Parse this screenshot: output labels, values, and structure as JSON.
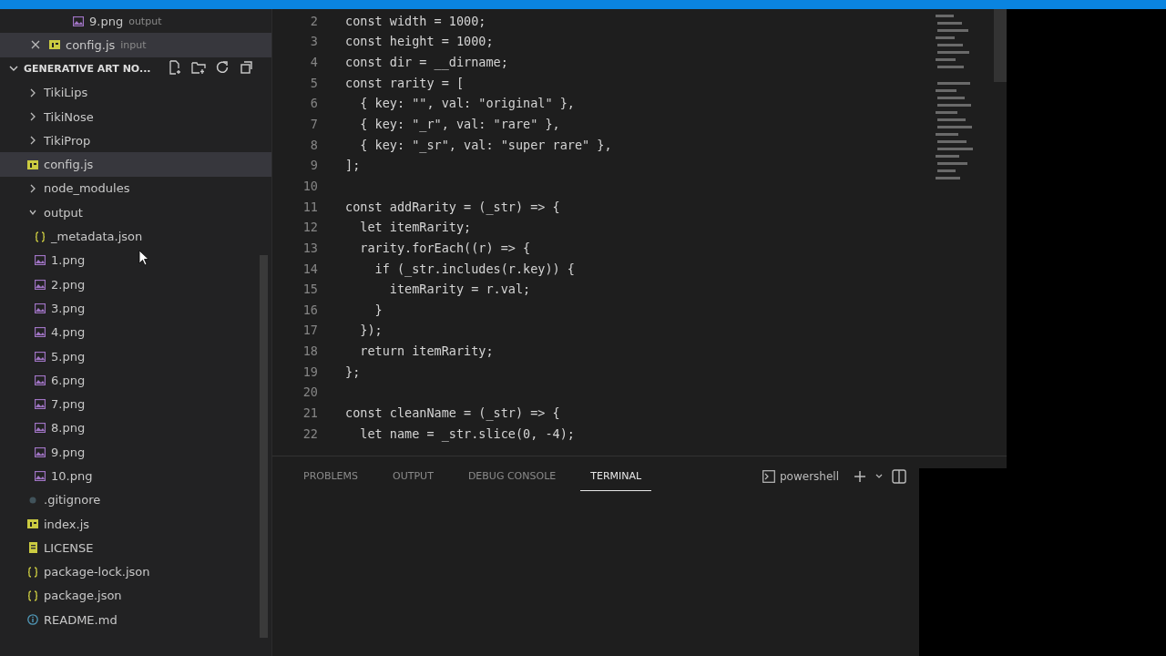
{
  "open_editors": [
    {
      "name": "9.png",
      "description": "output",
      "kind": "image",
      "selected": false
    },
    {
      "name": "config.js",
      "description": "input",
      "kind": "js",
      "selected": true
    }
  ],
  "explorer": {
    "title": "GENERATIVE ART NO...",
    "tree": [
      {
        "name": "TikiLips",
        "kind": "folder",
        "expanded": false,
        "selected": false
      },
      {
        "name": "TikiNose",
        "kind": "folder",
        "expanded": false,
        "selected": false
      },
      {
        "name": "TikiProp",
        "kind": "folder",
        "expanded": false,
        "selected": false
      },
      {
        "name": "config.js",
        "kind": "js",
        "selected": true
      },
      {
        "name": "node_modules",
        "kind": "folder",
        "expanded": false,
        "selected": false
      },
      {
        "name": "output",
        "kind": "folder",
        "expanded": true,
        "selected": false,
        "children": [
          {
            "name": "_metadata.json",
            "kind": "json",
            "selected": false
          },
          {
            "name": "1.png",
            "kind": "image",
            "selected": false
          },
          {
            "name": "2.png",
            "kind": "image",
            "selected": false
          },
          {
            "name": "3.png",
            "kind": "image",
            "selected": false
          },
          {
            "name": "4.png",
            "kind": "image",
            "selected": false
          },
          {
            "name": "5.png",
            "kind": "image",
            "selected": false
          },
          {
            "name": "6.png",
            "kind": "image",
            "selected": false
          },
          {
            "name": "7.png",
            "kind": "image",
            "selected": false
          },
          {
            "name": "8.png",
            "kind": "image",
            "selected": false
          },
          {
            "name": "9.png",
            "kind": "image",
            "selected": false
          },
          {
            "name": "10.png",
            "kind": "image",
            "selected": false
          }
        ]
      },
      {
        "name": ".gitignore",
        "kind": "git",
        "selected": false
      },
      {
        "name": "index.js",
        "kind": "js",
        "selected": false
      },
      {
        "name": "LICENSE",
        "kind": "license",
        "selected": false
      },
      {
        "name": "package-lock.json",
        "kind": "json",
        "selected": false
      },
      {
        "name": "package.json",
        "kind": "json",
        "selected": false
      },
      {
        "name": "README.md",
        "kind": "markdown",
        "selected": false
      }
    ]
  },
  "editor": {
    "lines": [
      {
        "number": "2",
        "text": "const width = 1000;"
      },
      {
        "number": "3",
        "text": "const height = 1000;"
      },
      {
        "number": "4",
        "text": "const dir = __dirname;"
      },
      {
        "number": "5",
        "text": "const rarity = ["
      },
      {
        "number": "6",
        "text": "  { key: \"\", val: \"original\" },"
      },
      {
        "number": "7",
        "text": "  { key: \"_r\", val: \"rare\" },"
      },
      {
        "number": "8",
        "text": "  { key: \"_sr\", val: \"super rare\" },"
      },
      {
        "number": "9",
        "text": "];"
      },
      {
        "number": "10"
      },
      {
        "number": "11",
        "text": "const addRarity = (_str) => {"
      },
      {
        "number": "12",
        "text": "  let itemRarity;"
      },
      {
        "number": "13",
        "text": "  rarity.forEach((r) => {"
      },
      {
        "number": "14",
        "text": "    if (_str.includes(r.key)) {"
      },
      {
        "number": "15",
        "text": "      itemRarity = r.val;"
      },
      {
        "number": "16",
        "text": "    }"
      },
      {
        "number": "17",
        "text": "  });"
      },
      {
        "number": "18",
        "text": "  return itemRarity;"
      },
      {
        "number": "19",
        "text": "};"
      },
      {
        "number": "20"
      },
      {
        "number": "21",
        "text": "const cleanName = (_str) => {"
      },
      {
        "number": "22",
        "text": "  let name = _str.slice(0, -4);"
      }
    ]
  },
  "panel": {
    "tabs": [
      {
        "label": "PROBLEMS",
        "selected": false
      },
      {
        "label": "OUTPUT",
        "selected": false
      },
      {
        "label": "DEBUG CONSOLE",
        "selected": false
      },
      {
        "label": "TERMINAL",
        "selected": true
      }
    ],
    "terminal_name": "powershell"
  }
}
